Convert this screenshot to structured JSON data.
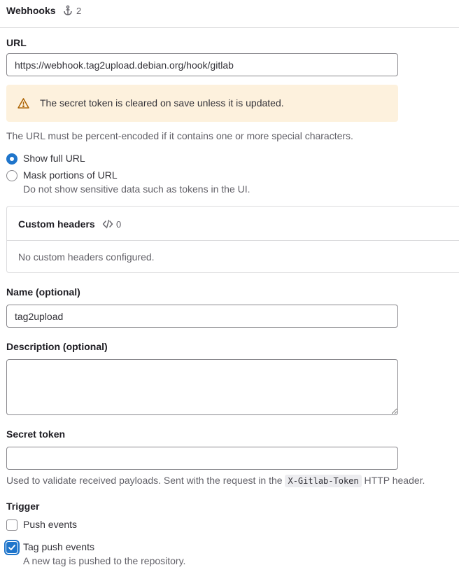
{
  "header": {
    "title": "Webhooks",
    "count": "2"
  },
  "url": {
    "label": "URL",
    "value": "https://webhook.tag2upload.debian.org/hook/gitlab",
    "alert": "The secret token is cleared on save unless it is updated.",
    "help": "The URL must be percent-encoded if it contains one or more special characters.",
    "options": [
      {
        "label": "Show full URL",
        "checked": true
      },
      {
        "label": "Mask portions of URL",
        "checked": false,
        "help": "Do not show sensitive data such as tokens in the UI."
      }
    ]
  },
  "custom_headers": {
    "title": "Custom headers",
    "count": "0",
    "empty": "No custom headers configured."
  },
  "name": {
    "label": "Name (optional)",
    "value": "tag2upload"
  },
  "description": {
    "label": "Description (optional)",
    "value": ""
  },
  "secret": {
    "label": "Secret token",
    "value": "",
    "help_prefix": "Used to validate received payloads. Sent with the request in the",
    "help_code": "X-Gitlab-Token",
    "help_suffix": "HTTP header."
  },
  "trigger": {
    "label": "Trigger",
    "items": [
      {
        "label": "Push events",
        "checked": false
      },
      {
        "label": "Tag push events",
        "checked": true,
        "help": "A new tag is pushed to the repository."
      }
    ]
  },
  "colors": {
    "accent": "#1f75cb",
    "warning_bg": "#fdf1dd",
    "warning_icon": "#ab6100"
  }
}
